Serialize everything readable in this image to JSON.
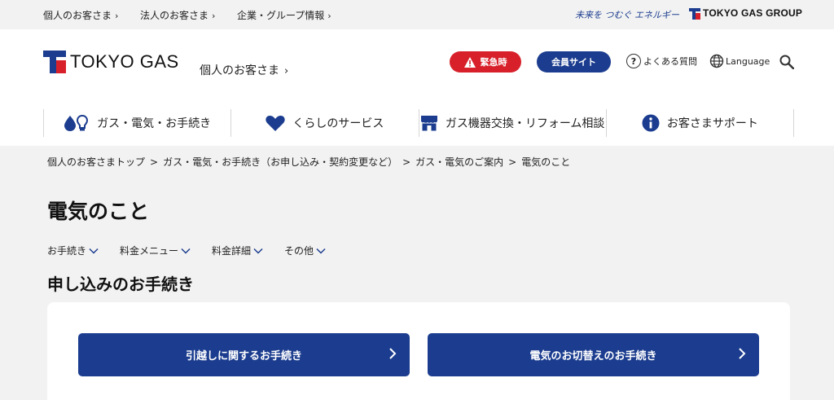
{
  "topbar": {
    "links": [
      {
        "label": "個人のお客さま"
      },
      {
        "label": "法人のお客さま"
      },
      {
        "label": "企業・グループ情報"
      }
    ],
    "slogan": "未来を つむぐ エネルギー",
    "group_logo_text": "TOKYO GAS GROUP"
  },
  "header": {
    "logo_text": "TOKYO GAS",
    "site_name": "個人のお客さま",
    "emergency_label": "緊急時",
    "member_label": "会員サイト",
    "faq_label": "よくある質問",
    "language_label": "Language"
  },
  "nav": {
    "items": [
      {
        "label": "ガス・電気・お手続き",
        "icon": "water-drop-bulb-icon"
      },
      {
        "label": "くらしのサービス",
        "icon": "heart-icon"
      },
      {
        "label": "ガス機器交換・リフォーム相談",
        "icon": "store-icon"
      },
      {
        "label": "お客さまサポート",
        "icon": "info-icon"
      }
    ]
  },
  "breadcrumb": {
    "items": [
      "個人のお客さまトップ",
      "ガス・電気・お手続き（お申し込み・契約変更など）",
      "ガス・電気のご案内",
      "電気のこと"
    ],
    "separator": ">"
  },
  "page": {
    "title": "電気のこと",
    "subnav": [
      "お手続き",
      "料金メニュー",
      "料金詳細",
      "その他"
    ],
    "section_title": "申し込みのお手続き",
    "cta": [
      "引越しに関するお手続き",
      "電気のお切替えのお手続き"
    ]
  },
  "colors": {
    "brand_blue": "#1c3d8f",
    "brand_red": "#d7202a",
    "background": "#f2f2f2"
  }
}
